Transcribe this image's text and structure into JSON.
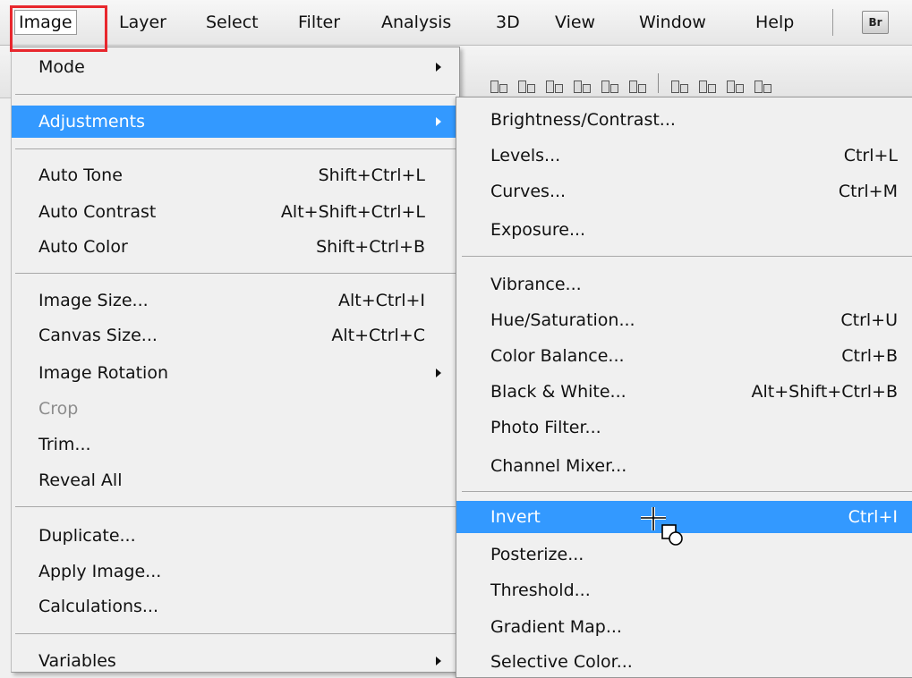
{
  "menubar": {
    "items": [
      "Image",
      "Layer",
      "Select",
      "Filter",
      "Analysis",
      "3D",
      "View",
      "Window",
      "Help"
    ],
    "bridge_badge": "Br",
    "highlight_color": "#e8272d"
  },
  "image_menu": {
    "items": [
      {
        "label": "Mode",
        "shortcut": "",
        "submenu": true
      },
      {
        "label": "Adjustments",
        "shortcut": "",
        "submenu": true,
        "highlighted": true
      },
      {
        "label": "Auto Tone",
        "shortcut": "Shift+Ctrl+L"
      },
      {
        "label": "Auto Contrast",
        "shortcut": "Alt+Shift+Ctrl+L"
      },
      {
        "label": "Auto Color",
        "shortcut": "Shift+Ctrl+B"
      },
      {
        "label": "Image Size...",
        "shortcut": "Alt+Ctrl+I"
      },
      {
        "label": "Canvas Size...",
        "shortcut": "Alt+Ctrl+C"
      },
      {
        "label": "Image Rotation",
        "shortcut": "",
        "submenu": true
      },
      {
        "label": "Crop",
        "shortcut": "",
        "disabled": true
      },
      {
        "label": "Trim...",
        "shortcut": ""
      },
      {
        "label": "Reveal All",
        "shortcut": ""
      },
      {
        "label": "Duplicate...",
        "shortcut": ""
      },
      {
        "label": "Apply Image...",
        "shortcut": ""
      },
      {
        "label": "Calculations...",
        "shortcut": ""
      },
      {
        "label": "Variables",
        "shortcut": "",
        "submenu": true
      }
    ]
  },
  "adjustments_menu": {
    "items": [
      {
        "label": "Brightness/Contrast...",
        "shortcut": ""
      },
      {
        "label": "Levels...",
        "shortcut": "Ctrl+L"
      },
      {
        "label": "Curves...",
        "shortcut": "Ctrl+M"
      },
      {
        "label": "Exposure...",
        "shortcut": ""
      },
      {
        "label": "Vibrance...",
        "shortcut": ""
      },
      {
        "label": "Hue/Saturation...",
        "shortcut": "Ctrl+U"
      },
      {
        "label": "Color Balance...",
        "shortcut": "Ctrl+B"
      },
      {
        "label": "Black & White...",
        "shortcut": "Alt+Shift+Ctrl+B"
      },
      {
        "label": "Photo Filter...",
        "shortcut": ""
      },
      {
        "label": "Channel Mixer...",
        "shortcut": ""
      },
      {
        "label": "Invert",
        "shortcut": "Ctrl+I",
        "highlighted": true
      },
      {
        "label": "Posterize...",
        "shortcut": ""
      },
      {
        "label": "Threshold...",
        "shortcut": ""
      },
      {
        "label": "Gradient Map...",
        "shortcut": ""
      },
      {
        "label": "Selective Color...",
        "shortcut": ""
      }
    ]
  },
  "colors": {
    "highlight": "#3399ff",
    "menu_bg": "#f0f0f0",
    "disabled_text": "#8d8d8d"
  }
}
